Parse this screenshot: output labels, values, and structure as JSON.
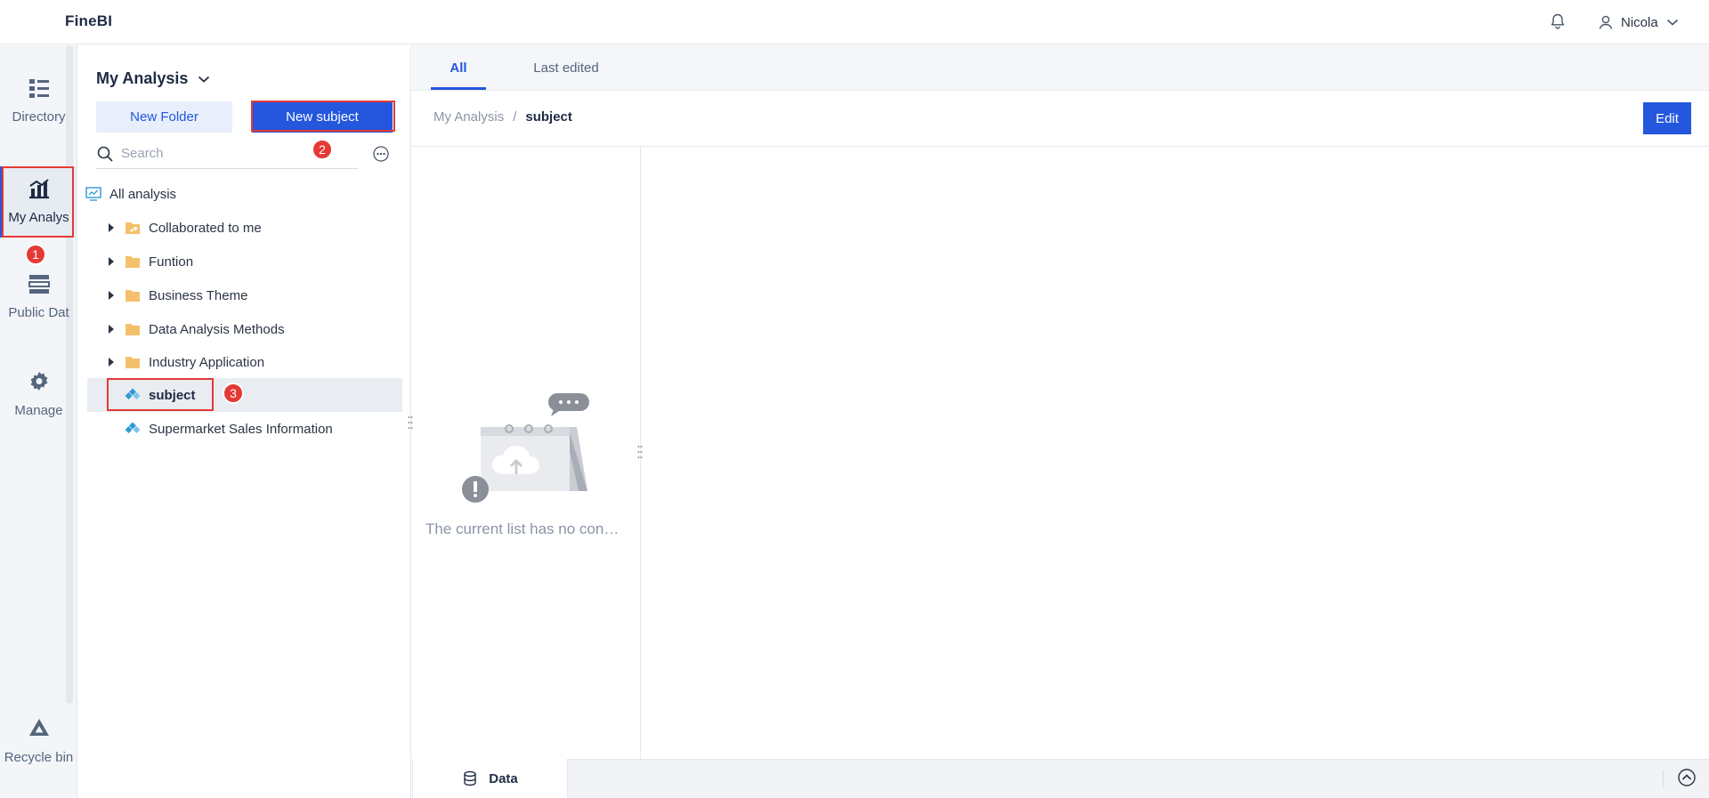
{
  "app": {
    "logo": "FineBI"
  },
  "header": {
    "user_name": "Nicola"
  },
  "rail": {
    "items": [
      {
        "label": "Directory",
        "icon": "directory-icon"
      },
      {
        "label": "My Analys",
        "icon": "analysis-chart-icon"
      },
      {
        "label": "Public Dat",
        "icon": "public-data-icon"
      },
      {
        "label": "Manage",
        "icon": "gear-icon"
      },
      {
        "label": "Recycle bin",
        "icon": "recycle-bin-icon"
      }
    ]
  },
  "panel": {
    "title": "My Analysis",
    "new_folder_label": "New Folder",
    "new_subject_label": "New subject",
    "search_placeholder": "Search",
    "tree": {
      "root": "All analysis",
      "items": [
        {
          "label": "Collaborated to me",
          "type": "shared-folder"
        },
        {
          "label": "Funtion",
          "type": "folder"
        },
        {
          "label": "Business Theme",
          "type": "folder"
        },
        {
          "label": "Data Analysis Methods",
          "type": "folder"
        },
        {
          "label": "Industry Application",
          "type": "folder"
        },
        {
          "label": "subject",
          "type": "subject",
          "selected": true
        },
        {
          "label": "Supermarket Sales Information",
          "type": "subject"
        }
      ]
    }
  },
  "annotations": {
    "step1": "1",
    "step2": "2",
    "step3": "3"
  },
  "main": {
    "tabs": [
      {
        "label": "All",
        "active": true
      },
      {
        "label": "Last edited"
      }
    ],
    "breadcrumb": {
      "parent": "My Analysis",
      "separator": "/",
      "current": "subject"
    },
    "edit_label": "Edit",
    "empty_text": "The current list has no con…"
  },
  "bottom": {
    "data_tab_label": "Data"
  },
  "colors": {
    "accent": "#2457de",
    "annotation": "#e53935"
  }
}
